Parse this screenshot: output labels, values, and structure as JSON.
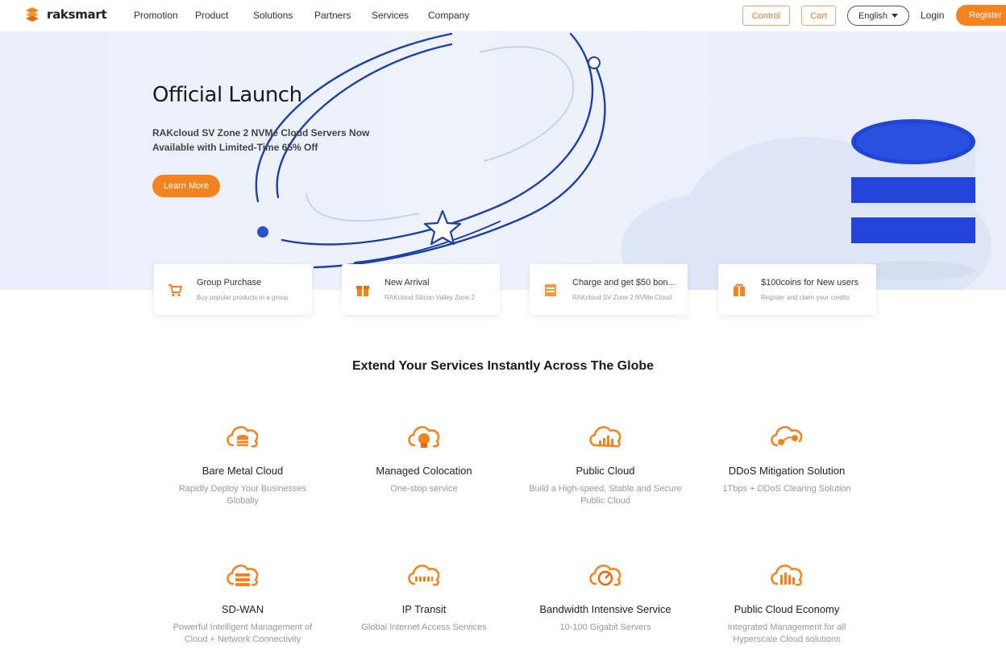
{
  "brand": {
    "name": "raksmart",
    "accent": "#f4821f",
    "hero_blue": "#1f3fa8"
  },
  "nav": {
    "items": [
      "Promotion",
      "Product",
      "Solutions",
      "Partners",
      "Services",
      "Company"
    ]
  },
  "header": {
    "control": "Control",
    "cart": "Cart",
    "language": "English",
    "login": "Login",
    "register": "Register"
  },
  "hero": {
    "title": "Official Launch",
    "subtitle": "RAKcloud SV Zone 2 NVMe Cloud Servers Now Available with Limited-Time 65% Off",
    "button": "Learn More"
  },
  "promos": [
    {
      "title": "Group Purchase",
      "desc": "Buy popular products in a group",
      "icon": "cart-icon"
    },
    {
      "title": "New Arrival",
      "desc": "RAKcloud Silicon Valley Zone 2",
      "icon": "gift-icon"
    },
    {
      "title": "Charge and get $50 bon...",
      "desc": "RAKcloud SV Zone 2 NVMe Cloud",
      "icon": "card-icon"
    },
    {
      "title": "$100coins for New users",
      "desc": "Register and claim your credits",
      "icon": "coin-gift-icon"
    }
  ],
  "section": {
    "title": "Extend Your Services Instantly Across The Globe"
  },
  "services": [
    {
      "title": "Bare Metal Cloud",
      "desc": "Rapidly Deploy Your Businesses Globally",
      "icon": "database-cloud-icon"
    },
    {
      "title": "Managed Colocation",
      "desc": "One-stop service",
      "icon": "server-cloud-icon"
    },
    {
      "title": "Public Cloud",
      "desc": "Build a High-speed, Stable and Secure Public Cloud",
      "icon": "chart-cloud-icon"
    },
    {
      "title": "DDoS Mitigation Solution",
      "desc": "1Tbps + DDoS Clearing Solution",
      "icon": "shield-cloud-icon"
    },
    {
      "title": "SD-WAN",
      "desc": "Powerful Intelligent Management of Cloud + Network Connectivity",
      "icon": "layers-cloud-icon"
    },
    {
      "title": "IP Transit",
      "desc": "Global Internet Access Services",
      "icon": "network-cloud-icon"
    },
    {
      "title": "Bandwidth Intensive Service",
      "desc": "10-100 Gigabit Servers",
      "icon": "gauge-cloud-icon"
    },
    {
      "title": "Public Cloud Economy",
      "desc": "Integrated Management for all Hyperscale Cloud solutions",
      "icon": "bars-cloud-icon"
    }
  ]
}
